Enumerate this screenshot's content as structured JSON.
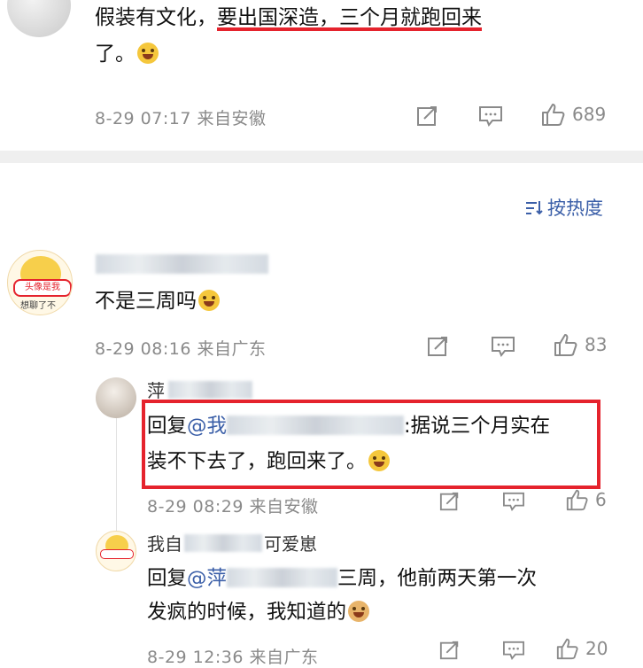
{
  "top_comment": {
    "text_line1_plain": "假装有文化，",
    "text_line1_underlined": "要出国深造，三个月就跑回来",
    "text_line2": "了。",
    "meta": "8-29 07:17 来自安徽",
    "likes": "689"
  },
  "sort_button": {
    "label": "按热度",
    "icon": "sort-lines-icon"
  },
  "comment1": {
    "avatar_caption": "头像是我",
    "avatar_subcaption": "想聊了不",
    "text": "不是三周吗",
    "meta": "8-29 08:16 来自广东",
    "likes": "83"
  },
  "reply1": {
    "name_visible": "萍",
    "reply_prefix": "回复",
    "mention": "@我",
    "text_after": ":据说三个月实在",
    "text_line2": "装不下去了，跑回来了。",
    "meta": "8-29 08:29 来自安徽",
    "likes": "6"
  },
  "reply2": {
    "name_prefix": "我自",
    "name_suffix": "可爱崽",
    "reply_prefix": "回复",
    "mention": "@萍",
    "text_after": "三周，他前两天第一次",
    "text_line2": "发疯的时候，我知道的",
    "meta": "8-29 12:36 来自广东",
    "likes": "20"
  },
  "colors": {
    "highlight_red": "#e5232d",
    "link_blue": "#3b5fa8",
    "meta_gray": "#8a8a8a",
    "divider": "#efefef"
  }
}
